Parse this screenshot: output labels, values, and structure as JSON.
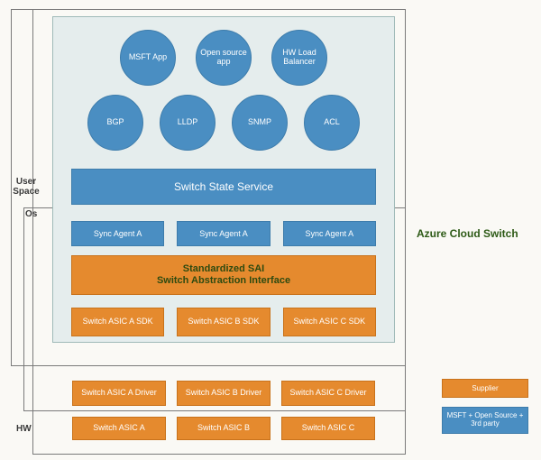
{
  "labels": {
    "user_space": "User Space",
    "os": "Os",
    "hw": "HW",
    "title": "Azure Cloud Switch"
  },
  "circles_top": [
    "MSFT App",
    "Open source app",
    "HW Load Balancer"
  ],
  "circles_bottom": [
    "BGP",
    "LLDP",
    "SNMP",
    "ACL"
  ],
  "switch_state": "Switch State Service",
  "sync": [
    "Sync Agent A",
    "Sync Agent A",
    "Sync Agent A"
  ],
  "sai": {
    "line1": "Standardized SAI",
    "line2": "Switch Abstraction Interface"
  },
  "sdk": [
    "Switch ASIC A SDK",
    "Switch ASIC B SDK",
    "Switch ASIC C SDK"
  ],
  "drivers": [
    "Switch ASIC A Driver",
    "Switch ASIC B Driver",
    "Switch ASIC C Driver"
  ],
  "hw": [
    "Switch ASIC A",
    "Switch ASIC B",
    "Switch ASIC C"
  ],
  "legend": {
    "supplier": "Supplier",
    "msft": "MSFT + Open Source + 3rd party"
  }
}
